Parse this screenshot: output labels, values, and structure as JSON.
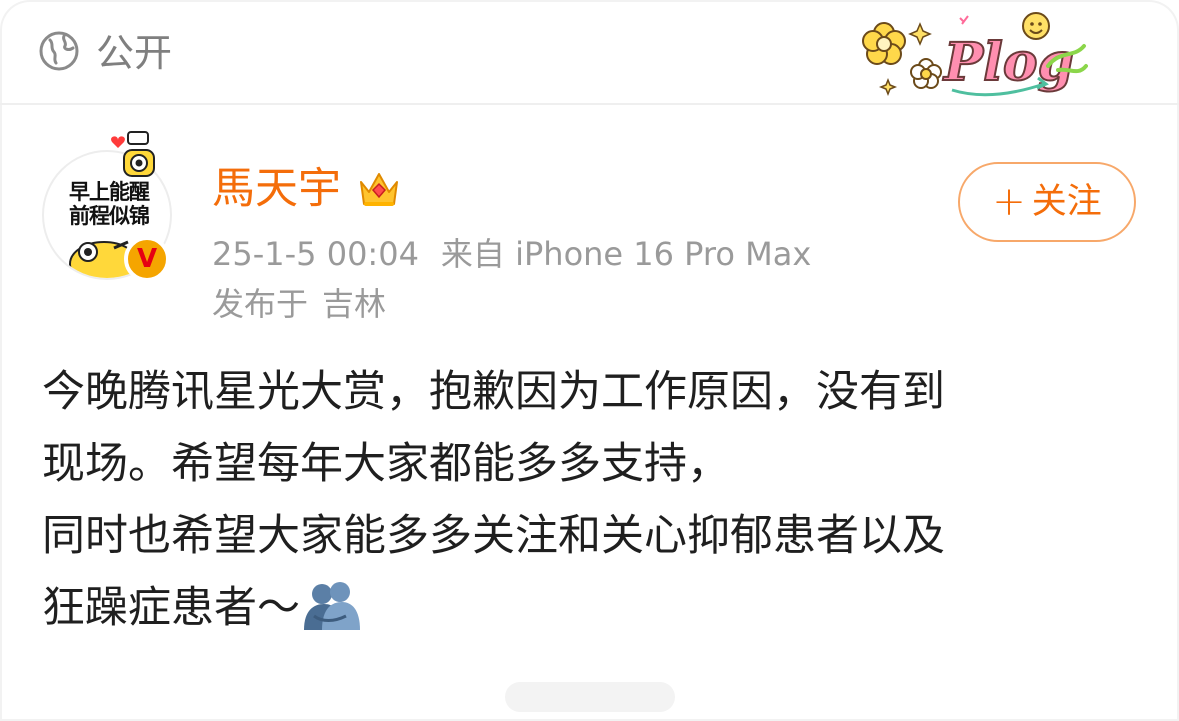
{
  "header": {
    "visibility_label": "公开",
    "visibility_icon": "globe-icon",
    "sticker_text": "Plog",
    "sticker_icon": "plog-sticker-icon"
  },
  "author": {
    "name": "馬天宇",
    "avatar_text_line1": "早上能醒",
    "avatar_text_line2": "前程似锦",
    "verified_badge": "V",
    "crown_icon": "crown-icon",
    "name_color": "#f46d0a"
  },
  "meta": {
    "timestamp": "25-1-5 00:04",
    "source": "来自 iPhone 16 Pro Max",
    "location_prefix": "发布于",
    "location": "吉林"
  },
  "follow_button": {
    "plus": "+",
    "label": "关注",
    "color": "#f46d0a"
  },
  "post": {
    "lines": [
      "今晚腾讯星光大赏，抱歉因为工作原因，没有到",
      "现场。希望每年大家都能多多支持，",
      "同时也希望大家能多多关注和关心抑郁患者以及",
      "狂躁症患者～"
    ],
    "emoji_icon": "hug-icon"
  }
}
